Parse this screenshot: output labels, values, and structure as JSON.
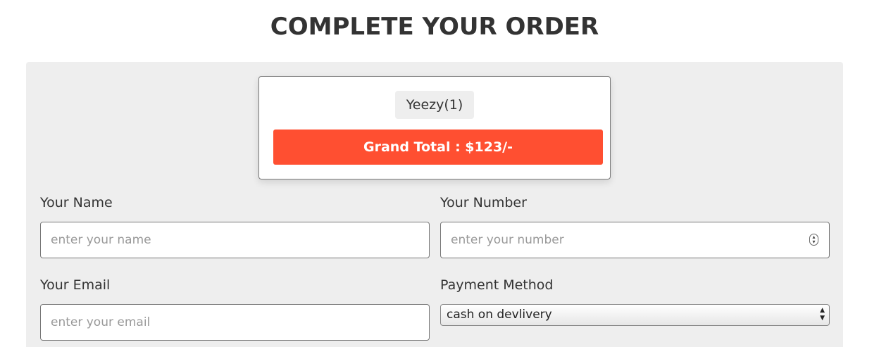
{
  "page": {
    "title": "COMPLETE YOUR ORDER"
  },
  "summary": {
    "item": "Yeezy(1)",
    "grand_total": "Grand Total : $123/-"
  },
  "form": {
    "name": {
      "label": "Your Name",
      "placeholder": "enter your name"
    },
    "number": {
      "label": "Your Number",
      "placeholder": "enter your number"
    },
    "email": {
      "label": "Your Email",
      "placeholder": "enter your email"
    },
    "payment": {
      "label": "Payment Method",
      "selected": "cash on devlivery"
    }
  },
  "colors": {
    "accent": "#ff4f31",
    "panel": "#eeeeee",
    "text": "#333333"
  },
  "icons": {
    "number_spinner": "spinner-arrows-icon",
    "select_arrows": "select-arrows-icon"
  }
}
